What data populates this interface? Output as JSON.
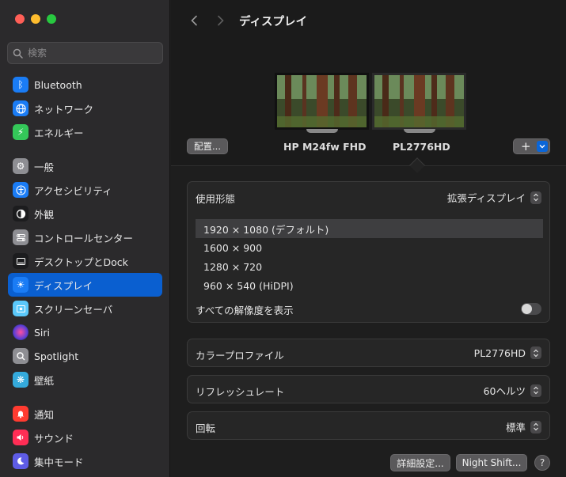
{
  "window": {
    "traffic_colors": [
      "#ff5f57",
      "#febc2e",
      "#28c840"
    ]
  },
  "search": {
    "placeholder": "検索"
  },
  "sidebar": {
    "items": [
      {
        "label": "Bluetooth",
        "icon": "bluetooth-icon",
        "color": "#1a7cf5"
      },
      {
        "label": "ネットワーク",
        "icon": "globe-icon",
        "color": "#1a7cf5"
      },
      {
        "label": "エネルギー",
        "icon": "bolt-icon",
        "color": "#34c759"
      },
      {
        "label": "一般",
        "icon": "gear-icon",
        "color": "#8e8e93"
      },
      {
        "label": "アクセシビリティ",
        "icon": "accessibility-icon",
        "color": "#1a7cf5"
      },
      {
        "label": "外観",
        "icon": "appearance-icon",
        "color": "#1c1c1e"
      },
      {
        "label": "コントロールセンター",
        "icon": "control-center-icon",
        "color": "#8e8e93"
      },
      {
        "label": "デスクトップとDock",
        "icon": "dock-icon",
        "color": "#1c1c1e"
      },
      {
        "label": "ディスプレイ",
        "icon": "sun-icon",
        "color": "#1a7cf5"
      },
      {
        "label": "スクリーンセーバ",
        "icon": "screensaver-icon",
        "color": "#5ac8fa"
      },
      {
        "label": "Siri",
        "icon": "siri-icon",
        "color": "#5b3fd6"
      },
      {
        "label": "Spotlight",
        "icon": "spotlight-icon",
        "color": "#8e8e93"
      },
      {
        "label": "壁紙",
        "icon": "wallpaper-icon",
        "color": "#34aadc"
      },
      {
        "label": "通知",
        "icon": "bell-icon",
        "color": "#ff3b30"
      },
      {
        "label": "サウンド",
        "icon": "speaker-icon",
        "color": "#ff2d55"
      },
      {
        "label": "集中モード",
        "icon": "moon-icon",
        "color": "#5e5ce6"
      }
    ],
    "active_index": 8
  },
  "header": {
    "title": "ディスプレイ"
  },
  "arrangement": {
    "arrange_button": "配置...",
    "add_button": "+",
    "displays": [
      {
        "name": "HP M24fw FHD"
      },
      {
        "name": "PL2776HD"
      }
    ]
  },
  "usage": {
    "label": "使用形態",
    "value": "拡張ディスプレイ",
    "resolutions": [
      "1920 × 1080 (デフォルト)",
      "1600 × 900",
      "1280 × 720",
      "960 × 540 (HiDPI)"
    ],
    "selected_index": 0,
    "show_all_label": "すべての解像度を表示"
  },
  "color_profile": {
    "label": "カラープロファイル",
    "value": "PL2776HD"
  },
  "refresh_rate": {
    "label": "リフレッシュレート",
    "value": "60ヘルツ"
  },
  "rotation": {
    "label": "回転",
    "value": "標準"
  },
  "footer": {
    "advanced_button": "詳細設定...",
    "night_shift_button": "Night Shift...",
    "help_button": "?"
  }
}
